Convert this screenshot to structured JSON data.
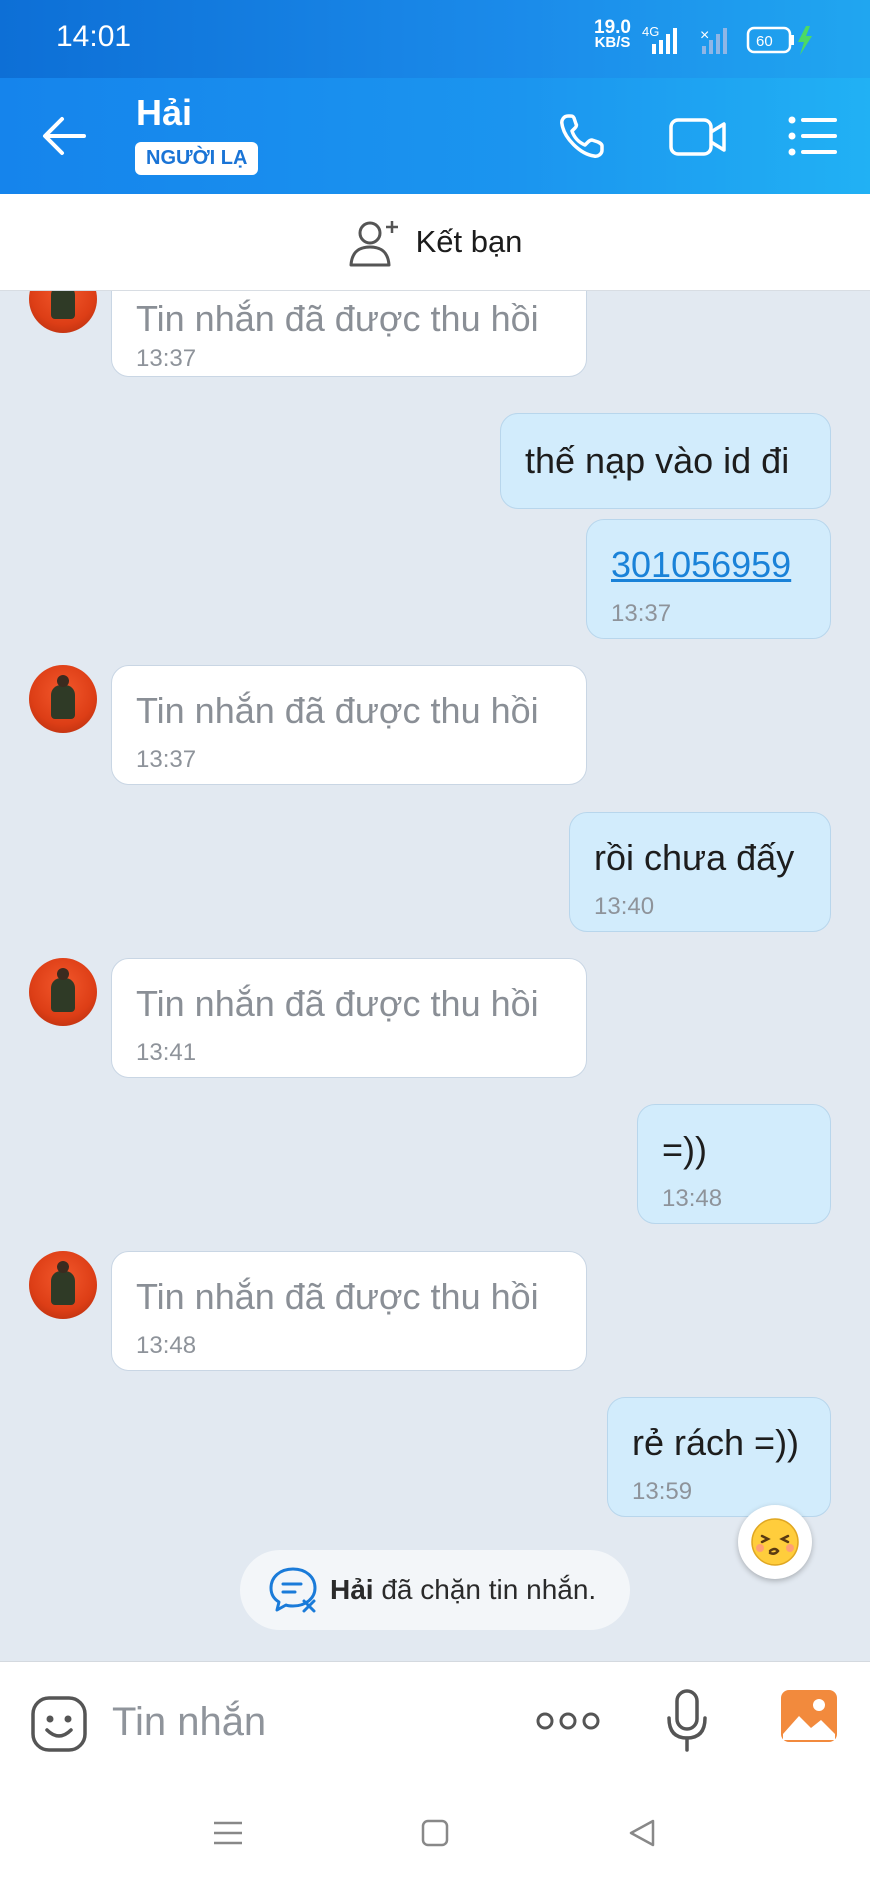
{
  "status": {
    "time": "14:01",
    "speed_value": "19.0",
    "speed_unit": "KB/S",
    "network": "4G",
    "battery": "60"
  },
  "header": {
    "name": "Hải",
    "badge": "NGƯỜI LẠ"
  },
  "add_friend": {
    "label": "Kết bạn"
  },
  "messages": [
    {
      "dir": "in",
      "text": "Tin nhắn đã được thu hồi",
      "time": "13:37"
    },
    {
      "dir": "out",
      "text": "thế nạp vào id đi",
      "time": ""
    },
    {
      "dir": "out",
      "text": "301056959",
      "time": "13:37"
    },
    {
      "dir": "in",
      "text": "Tin nhắn đã được thu hồi",
      "time": "13:37"
    },
    {
      "dir": "out",
      "text": "rồi chưa đấy",
      "time": "13:40"
    },
    {
      "dir": "in",
      "text": "Tin nhắn đã được thu hồi",
      "time": "13:41"
    },
    {
      "dir": "out",
      "text": "=))",
      "time": "13:48"
    },
    {
      "dir": "in",
      "text": "Tin nhắn đã được thu hồi",
      "time": "13:48"
    },
    {
      "dir": "out",
      "text": "rẻ rách =))",
      "time": "13:59"
    }
  ],
  "blocked_notice": {
    "name": "Hải",
    "text": " đã chặn tin nhắn."
  },
  "composer": {
    "placeholder": "Tin nhắn"
  },
  "colors": {
    "header_blue": "#1584ec",
    "out_bubble": "#d2ecfc",
    "chat_bg": "#e2e9f1",
    "link": "#1a82d8"
  }
}
